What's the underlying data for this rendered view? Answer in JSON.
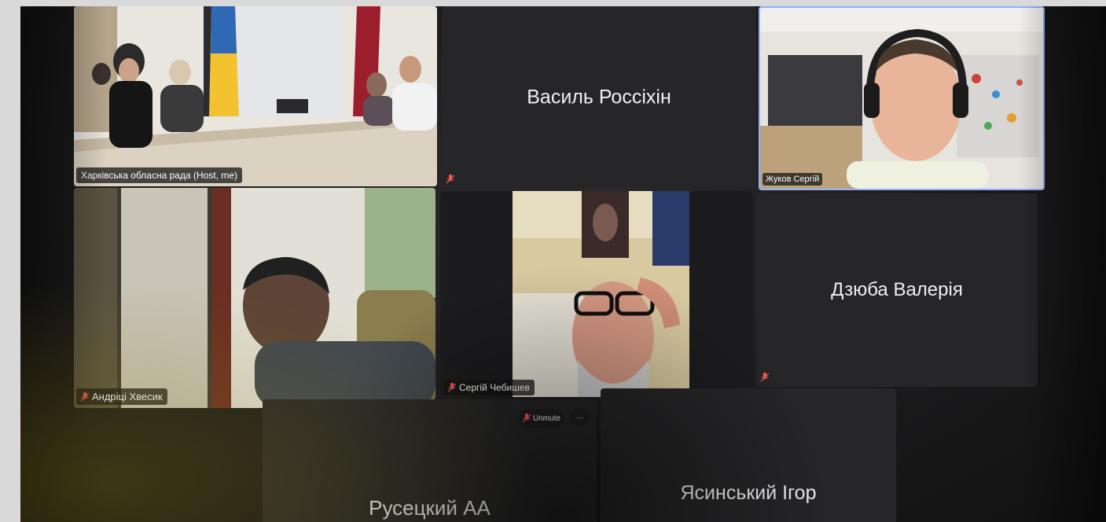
{
  "participants": [
    {
      "id": "p1",
      "name": "Харківська обласна рада (Host, me)",
      "video": true,
      "muted": false
    },
    {
      "id": "p2",
      "name": "Василь Россіхін",
      "video": false,
      "muted": true
    },
    {
      "id": "p3",
      "name": "Жуков Сергій",
      "video": true,
      "muted": false,
      "active_speaker": true
    },
    {
      "id": "p4",
      "name": "Андріці Хвесик",
      "video": true,
      "muted": true
    },
    {
      "id": "p5",
      "name": "Сергій Чебишев",
      "video": true,
      "muted": true
    },
    {
      "id": "p6",
      "name": "Дзюба Валерія",
      "video": false,
      "muted": true
    },
    {
      "id": "p7",
      "name": "Русецкий АА",
      "video": false,
      "muted": false
    },
    {
      "id": "p8",
      "name": "Ясинський Ігор",
      "video": false,
      "muted": false
    }
  ],
  "controls": {
    "unmute_label": "Unmute",
    "more_label": "···"
  },
  "colors": {
    "muted_icon": "#ff5a5a",
    "active_speaker_border": "#8fb3ff",
    "tile_bg": "#262628"
  }
}
